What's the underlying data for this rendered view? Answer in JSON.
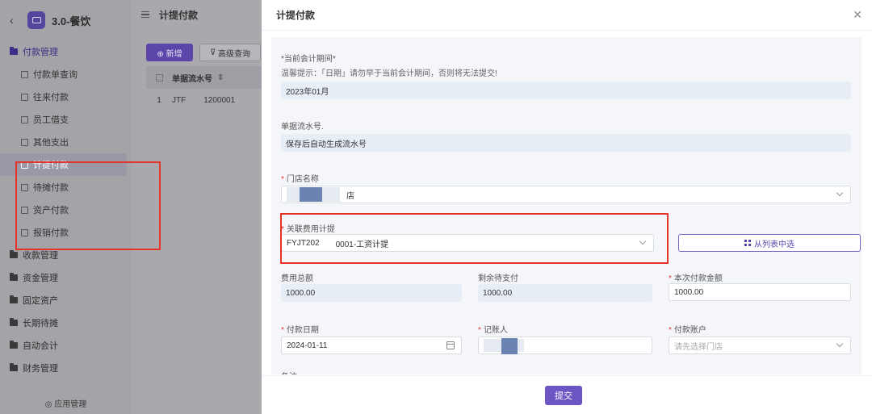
{
  "app": {
    "back_icon": "chevron-left-icon",
    "title": "3.0-餐饮",
    "logo_icon": "app-logo-icon"
  },
  "sidebar": {
    "group_open": "付款管理",
    "items": [
      "付款单查询",
      "往来付款",
      "员工借支",
      "其他支出",
      "计提付款",
      "待摊付款",
      "资产付款",
      "报销付款"
    ],
    "active_item": "计提付款",
    "groups": [
      "收款管理",
      "资金管理",
      "固定资产",
      "长期待摊",
      "自动会计",
      "财务管理"
    ],
    "footer": "◎ 应用管理"
  },
  "page": {
    "title": "计提付款",
    "new_button": "⊕ 新增",
    "search_button": "高级查询",
    "table_header": "单据流水号",
    "row_index": "1",
    "row_serial_prefix": "JTF",
    "row_serial_suffix": "1200001"
  },
  "drawer": {
    "title": "计提付款",
    "close_icon": "close-icon",
    "period_label": "*当前会计期间*",
    "period_note": "温馨提示：「日期」请勿早于当前会计期间，否则将无法提交!",
    "period_value": "2023年01月",
    "serial_label": "单据流水号.",
    "serial_value": "保存后自动生成流水号",
    "store_label": "门店名称",
    "store_value": "店",
    "accrual_label": "关联费用计提",
    "accrual_value_prefix": "FYJT202",
    "accrual_value_suffix": "0001-工资计提",
    "select_from_list": "从列表中选",
    "total_label": "费用总额",
    "total_value": "1000.00",
    "remaining_label": "剩余待支付",
    "remaining_value": "1000.00",
    "pay_amount_label": "本次付款金额",
    "pay_amount_value": "1000.00",
    "pay_date_label": "付款日期",
    "pay_date_value": "2024-01-11",
    "bookkeeper_label": "记账人",
    "account_label": "付款账户",
    "account_placeholder": "请先选择门店",
    "remark_label": "备注",
    "submit_button": "提交"
  },
  "colors": {
    "accent": "#6d55c3",
    "highlight": "#e5332a"
  }
}
